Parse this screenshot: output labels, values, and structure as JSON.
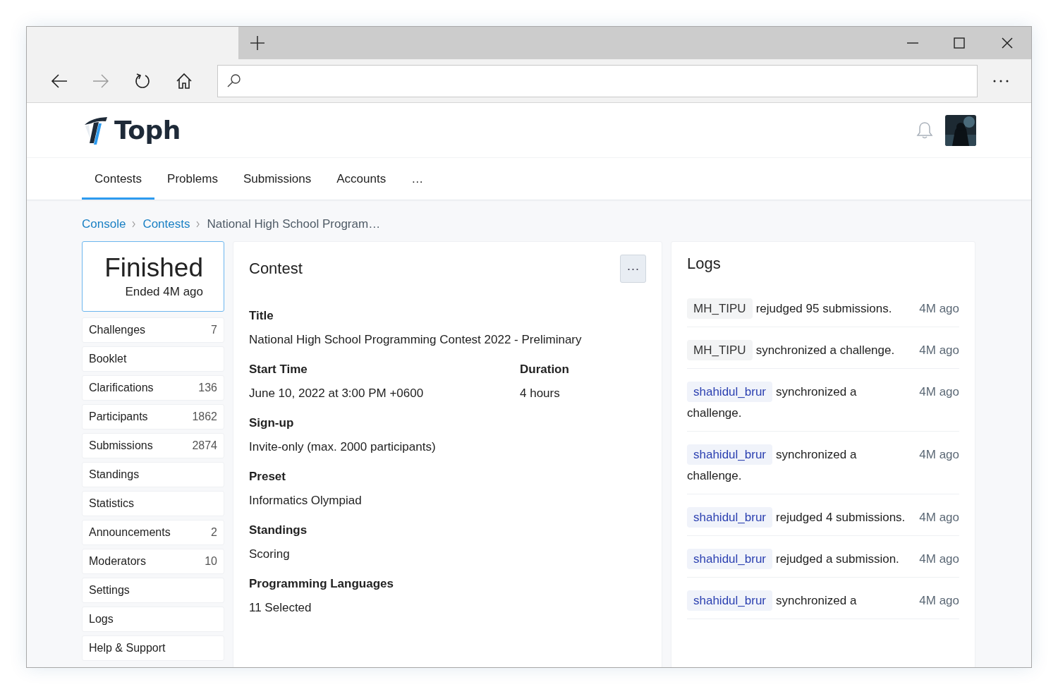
{
  "browser": {
    "forward_disabled": true
  },
  "site": {
    "logo": "Toph"
  },
  "nav": [
    {
      "label": "Contests",
      "selected": true
    },
    {
      "label": "Problems",
      "selected": false
    },
    {
      "label": "Submissions",
      "selected": false
    },
    {
      "label": "Accounts",
      "selected": false
    },
    {
      "label": "…",
      "selected": false
    }
  ],
  "breadcrumb": [
    {
      "label": "Console",
      "kind": "link"
    },
    {
      "label": "Contests",
      "kind": "link"
    },
    {
      "label": "National High School Program…",
      "kind": "current"
    }
  ],
  "status": {
    "title": "Finished",
    "subtitle": "Ended 4M ago"
  },
  "sidebar": {
    "items": [
      {
        "label": "Challenges",
        "count": "7"
      },
      {
        "label": "Booklet"
      },
      {
        "label": "Clarifications",
        "count": "136"
      },
      {
        "label": "Participants",
        "count": "1862"
      },
      {
        "label": "Submissions",
        "count": "2874"
      },
      {
        "label": "Standings"
      },
      {
        "label": "Statistics"
      },
      {
        "label": "Announcements",
        "count": "2"
      },
      {
        "label": "Moderators",
        "count": "10"
      },
      {
        "label": "Settings"
      },
      {
        "label": "Logs"
      },
      {
        "label": "Help & Support"
      }
    ]
  },
  "contest": {
    "heading": "Contest",
    "menu": "···",
    "fields": [
      [
        {
          "label": "Title",
          "value": "National High School Programming Contest 2022 - Preliminary"
        }
      ],
      [
        {
          "label": "Start Time",
          "value": "June 10, 2022 at 3:00 PM +0600"
        },
        {
          "label": "Duration",
          "value": "4 hours"
        }
      ],
      [
        {
          "label": "Sign-up",
          "value": "Invite-only (max. 2000 participants)"
        }
      ],
      [
        {
          "label": "Preset",
          "value": "Informatics Olympiad"
        }
      ],
      [
        {
          "label": "Standings",
          "value": "Scoring"
        }
      ],
      [
        {
          "label": "Programming Languages",
          "value": "11 Selected"
        }
      ]
    ]
  },
  "logs": {
    "heading": "Logs",
    "entries": [
      {
        "user": "MH_TIPU",
        "kind": "plain",
        "text": "rejudged 95 submissions.",
        "time": "4M ago"
      },
      {
        "user": "MH_TIPU",
        "kind": "plain",
        "text": "synchronized a challenge.",
        "time": "4M ago"
      },
      {
        "user": "shahidul_brur",
        "kind": "link",
        "text": "synchronized a challenge.",
        "time": "4M ago"
      },
      {
        "user": "shahidul_brur",
        "kind": "link",
        "text": "synchronized a challenge.",
        "time": "4M ago"
      },
      {
        "user": "shahidul_brur",
        "kind": "link",
        "text": "rejudged 4 submissions.",
        "time": "4M ago"
      },
      {
        "user": "shahidul_brur",
        "kind": "link",
        "text": "rejudged a submission.",
        "time": "4M ago"
      },
      {
        "user": "shahidul_brur",
        "kind": "link",
        "text": "synchronized a",
        "time": "4M ago"
      }
    ]
  }
}
